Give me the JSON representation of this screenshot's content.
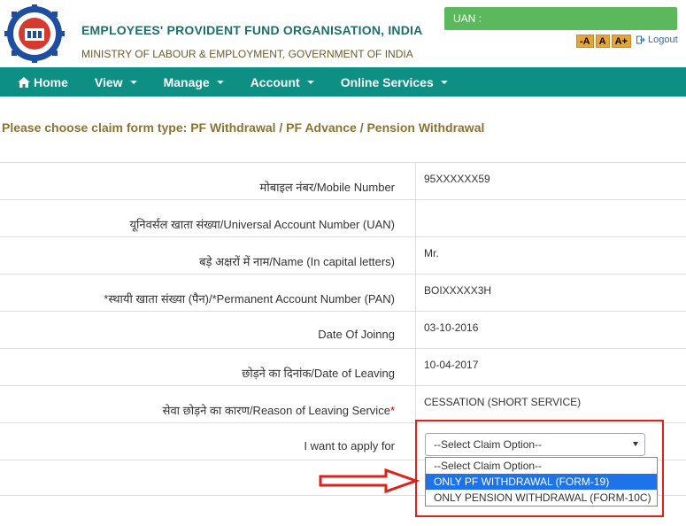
{
  "header": {
    "org_title": "EMPLOYEES' PROVIDENT FUND ORGANISATION, INDIA",
    "org_subtitle": "MINISTRY OF LABOUR & EMPLOYMENT, GOVERNMENT OF INDIA",
    "uan_label": "UAN :",
    "font_buttons": [
      "-A",
      "A",
      "A+"
    ],
    "logout_label": "Logout"
  },
  "nav": {
    "items": [
      "Home",
      "View",
      "Manage",
      "Account",
      "Online Services"
    ]
  },
  "page": {
    "heading": "Please choose claim form type: PF Withdrawal / PF Advance / Pension Withdrawal"
  },
  "form": {
    "rows": [
      {
        "label": "मोबाइल नंबर/Mobile Number",
        "value": "95XXXXXX59"
      },
      {
        "label": "यूनिवर्सल खाता संख्या/Universal Account Number (UAN)",
        "value": ""
      },
      {
        "label": "बड़े अक्षरों में नाम/Name (In capital letters)",
        "value": "Mr."
      },
      {
        "label": "*स्थायी खाता संख्या (पैन)/*Permanent Account Number (PAN)",
        "value": "BOIXXXXX3H"
      },
      {
        "label": "Date Of Joinng",
        "value": "03-10-2016"
      },
      {
        "label": "छोड़ने का दिनांक/Date of Leaving",
        "value": "10-04-2017"
      },
      {
        "label": "सेवा छोड़ने का कारण/Reason of Leaving Service",
        "required_mark": "*",
        "value": "CESSATION (SHORT SERVICE)"
      },
      {
        "label": "I want to apply for",
        "value": ""
      }
    ],
    "select_value": "--Select Claim Option--",
    "options": [
      "--Select Claim Option--",
      "ONLY PF WITHDRAWAL (FORM-19)",
      "ONLY PENSION WITHDRAWAL (FORM-10C)"
    ],
    "highlighted_option_index": 1
  },
  "colors": {
    "navbar": "#0e8f84",
    "uan_box": "#5cb85c",
    "heading": "#8b7334",
    "highlight": "#1e73e8",
    "annotation_red": "#e0201b"
  }
}
